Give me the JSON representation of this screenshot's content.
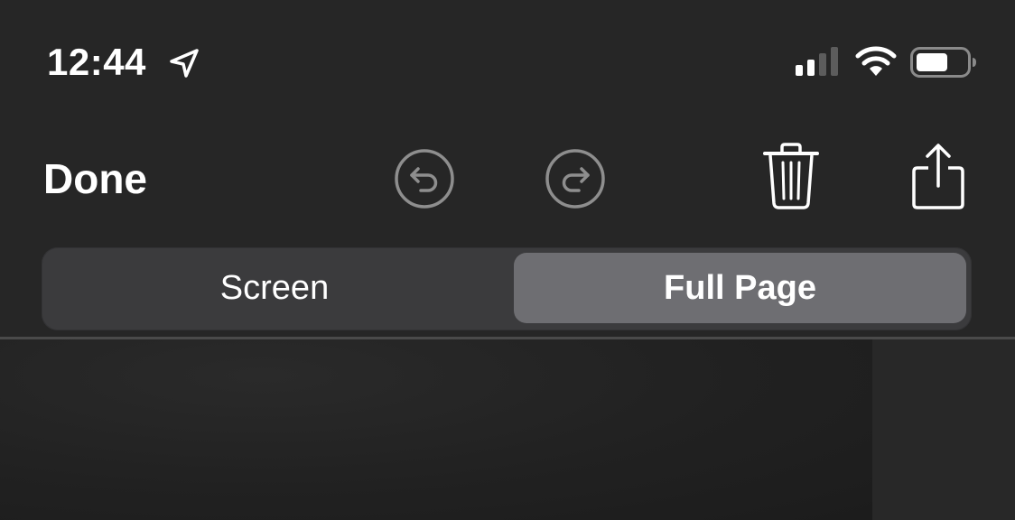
{
  "status_bar": {
    "time": "12:44",
    "icons": [
      "location-arrow-icon",
      "cellular-signal-icon",
      "wifi-icon",
      "battery-icon"
    ]
  },
  "toolbar": {
    "done_label": "Done",
    "icons": [
      "undo-icon",
      "redo-icon",
      "trash-icon",
      "share-icon"
    ]
  },
  "segmented_control": {
    "segments": [
      {
        "label": "Screen",
        "selected": false
      },
      {
        "label": "Full Page",
        "selected": true
      }
    ]
  },
  "colors": {
    "background": "#262626",
    "segment_track": "#3b3b3d",
    "segment_selected": "#6e6e72",
    "disabled_icon": "#8e8e8e"
  }
}
